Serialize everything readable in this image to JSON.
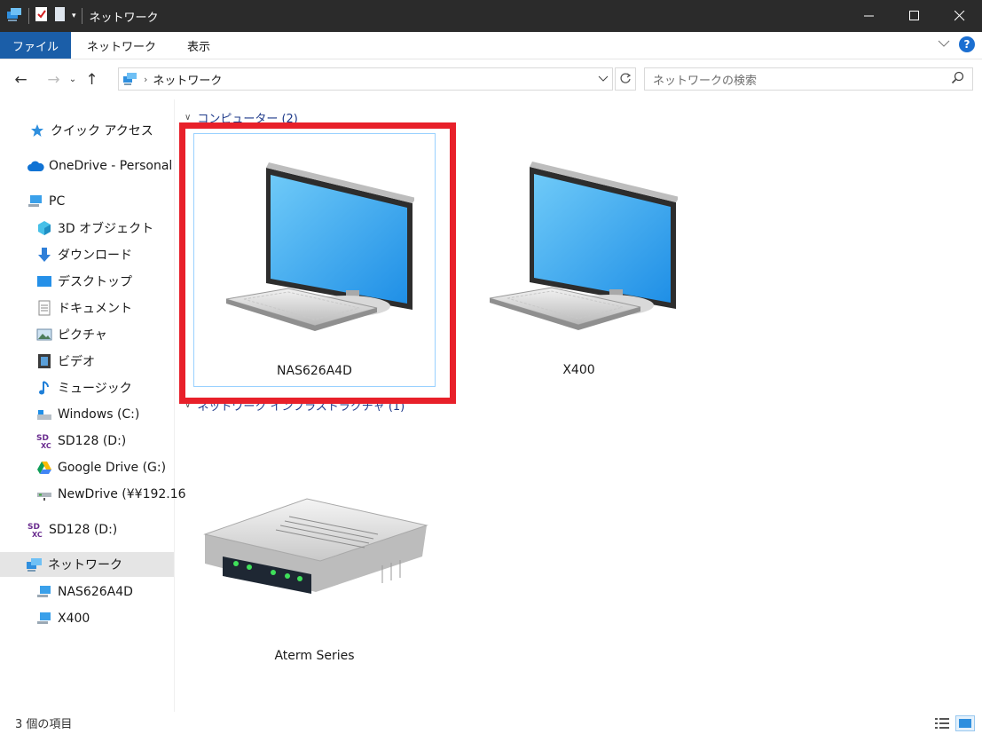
{
  "window": {
    "title": "ネットワーク"
  },
  "ribbon": {
    "tabs": [
      "ファイル",
      "ネットワーク",
      "表示"
    ]
  },
  "address": {
    "crumbs": [
      "ネットワーク"
    ]
  },
  "search": {
    "placeholder": "ネットワークの検索"
  },
  "sidebar": {
    "items": [
      {
        "label": "クイック アクセス",
        "icon": "star-icon"
      },
      {
        "label": "OneDrive - Personal",
        "icon": "cloud-icon"
      },
      {
        "label": "PC",
        "icon": "pc-icon"
      },
      {
        "label": "3D オブジェクト",
        "icon": "cube-icon"
      },
      {
        "label": "ダウンロード",
        "icon": "download-arrow-icon"
      },
      {
        "label": "デスクトップ",
        "icon": "desktop-icon"
      },
      {
        "label": "ドキュメント",
        "icon": "document-icon"
      },
      {
        "label": "ピクチャ",
        "icon": "picture-icon"
      },
      {
        "label": "ビデオ",
        "icon": "film-icon"
      },
      {
        "label": "ミュージック",
        "icon": "music-note-icon"
      },
      {
        "label": "Windows (C:)",
        "icon": "drive-icon"
      },
      {
        "label": "SD128 (D:)",
        "icon": "sdxc-icon"
      },
      {
        "label": "Google Drive (G:)",
        "icon": "google-drive-icon"
      },
      {
        "label": "NewDrive (¥¥192.16",
        "icon": "network-drive-icon"
      },
      {
        "label": "SD128 (D:)",
        "icon": "sdxc-icon"
      },
      {
        "label": "ネットワーク",
        "icon": "network-icon"
      },
      {
        "label": "NAS626A4D",
        "icon": "computer-icon"
      },
      {
        "label": "X400",
        "icon": "computer-icon"
      }
    ]
  },
  "content": {
    "groups": [
      {
        "title": "コンピューター (2)"
      },
      {
        "title": "ネットワーク インフラストラクチャ (1)"
      }
    ],
    "computers": [
      "NAS626A4D",
      "X400"
    ],
    "infrastructure": [
      "Aterm Series"
    ]
  },
  "status": {
    "text": "3 個の項目"
  }
}
